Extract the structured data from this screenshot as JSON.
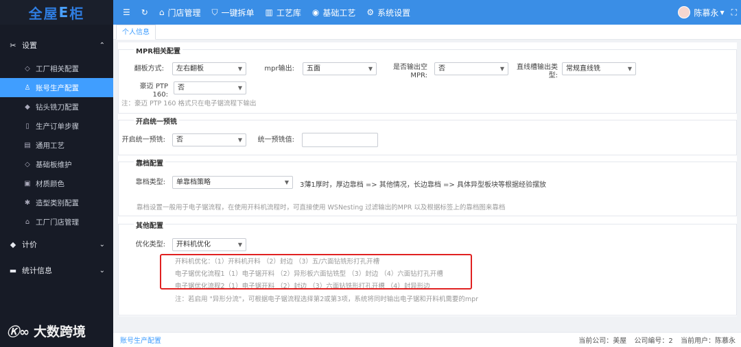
{
  "app": {
    "logo_prefix": "全屋",
    "logo_e": "E",
    "logo_suffix": "柜"
  },
  "topbar": {
    "menu": "门店管理",
    "split": "一键拆单",
    "process_lib": "工艺库",
    "basic_process": "基础工艺",
    "system_settings": "系统设置",
    "user_name": "陈慕永"
  },
  "sidebar": {
    "settings_label": "设置",
    "items": [
      {
        "label": "工厂相关配置",
        "icon": "tag-icon"
      },
      {
        "label": "账号生产配置",
        "icon": "user-icon"
      },
      {
        "label": "钻头铣刀配置",
        "icon": "gem-icon"
      },
      {
        "label": "生产订单步骤",
        "icon": "book-icon"
      },
      {
        "label": "通用工艺",
        "icon": "list-icon"
      },
      {
        "label": "基础板维护",
        "icon": "tag-icon"
      },
      {
        "label": "材质颜色",
        "icon": "image-icon"
      },
      {
        "label": "造型类别配置",
        "icon": "star-icon"
      },
      {
        "label": "工厂门店管理",
        "icon": "home-icon"
      }
    ],
    "pricing_label": "计价",
    "stats_label": "统计信息"
  },
  "watermark": "大数跨境",
  "tab": "个人信息",
  "mpr": {
    "title": "MPR相关配置",
    "flip_label": "翻板方式:",
    "flip_value": "左右翻板",
    "mpr_out_label": "mpr输出:",
    "mpr_out_value": "五面",
    "empty_label": "是否输出空MPR:",
    "empty_value": "否",
    "slot_label": "直线槽输出类型:",
    "slot_value": "常规直线铣",
    "haomai_label": "豪迈 PTP 160:",
    "haomai_value": "否",
    "note": "注：豪迈 PTP 160 格式只在电子锯流程下输出"
  },
  "premill": {
    "title": "开启统一预铣",
    "enable_label": "开启统一预铣:",
    "enable_value": "否",
    "value_label": "统一预铣值:",
    "value": ""
  },
  "stop": {
    "title": "靠档配置",
    "type_label": "靠档类型:",
    "type_value": "单靠档策略",
    "desc": "3薄1厚时，厚边靠档 => 其他情况，长边靠档 => 具体异型板块等根据经验摆放",
    "note": "靠档设置一般用于电子锯流程，在使用开料机流程时，可直接使用 WSNesting 过滤输出的MPR 以及根据标签上的靠档图来靠档"
  },
  "other": {
    "title": "其他配置",
    "opt_label": "优化类型:",
    "opt_value": "开料机优化",
    "line1": "开料机优化：（1）开料机开料 （2）封边 （3）五/六面钻铣形打孔开槽",
    "line2": "电子锯优化流程1（1）电子锯开料 （2）异形板六面钻铣型 （3）封边 （4）六面钻打孔开槽",
    "line3": "电子锯优化流程2（1）电子锯开料 （2）封边 （3）六面钻铣形打孔开槽 （4）封异形边",
    "note": "注：若启用 \"异形分流\"，可根据电子锯流程选择第2或第3项，系统将同时输出电子锯和开料机需要的mpr"
  },
  "footer": {
    "crumb": "账号生产配置",
    "company": "当前公司：美屋",
    "company_no": "公司编号：2",
    "current_user": "当前用户：陈慕永"
  }
}
